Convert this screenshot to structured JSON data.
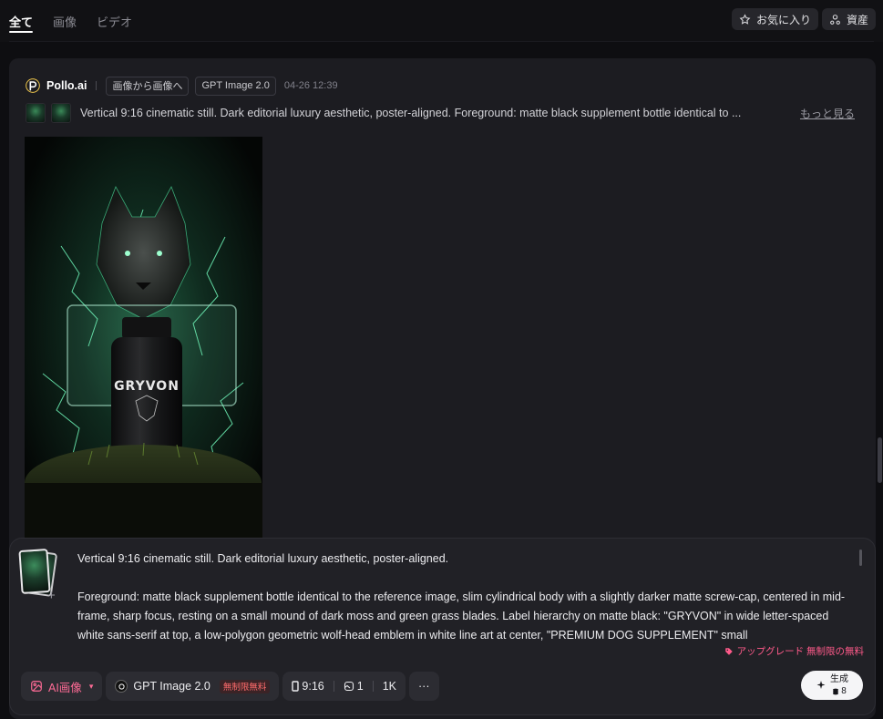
{
  "topbar": {
    "tabs": [
      {
        "label": "全て",
        "active": true
      },
      {
        "label": "画像",
        "active": false
      },
      {
        "label": "ビデオ",
        "active": false
      }
    ],
    "favorites_label": "お気に入り",
    "assets_label": "資産"
  },
  "card": {
    "brand_name": "Pollo.ai",
    "mode_tag": "画像から画像へ",
    "model_tag": "GPT Image 2.0",
    "timestamp": "04-26 12:39",
    "prompt_preview": "Vertical 9:16 cinematic still. Dark editorial luxury aesthetic, poster-aligned. Foreground: matte black supplement bottle identical to ...",
    "more_label": "もっと見る",
    "image": {
      "bottle_label": "GRYVON"
    }
  },
  "composer": {
    "line1": "Vertical 9:16 cinematic still. Dark editorial luxury aesthetic, poster-aligned.",
    "line2": "Foreground: matte black supplement bottle identical to the reference image, slim cylindrical body with a slightly darker matte screw-cap, centered in mid-frame, sharp focus, resting on a small mound of dark moss and green grass blades. Label hierarchy on matte black: \"GRYVON\" in wide letter-spaced white sans-serif at top, a low-polygon geometric wolf-head emblem in white line art at center, \"PREMIUM DOG SUPPLEMENT\" small",
    "upgrade_text": "アップグレード 無制限の無料",
    "ai_mode_label": "AI画像",
    "model_label": "GPT Image 2.0",
    "model_badge": "無制限無料",
    "aspect_ratio": "9:16",
    "count": "1",
    "resolution": "1K",
    "more_options": "···",
    "generate_label": "生成",
    "generate_credits": "8"
  },
  "colors": {
    "accent_pink": "#ff6b96",
    "background": "#0e0e11",
    "card": "#1c1c21",
    "glow_green": "#5cf0a8"
  }
}
